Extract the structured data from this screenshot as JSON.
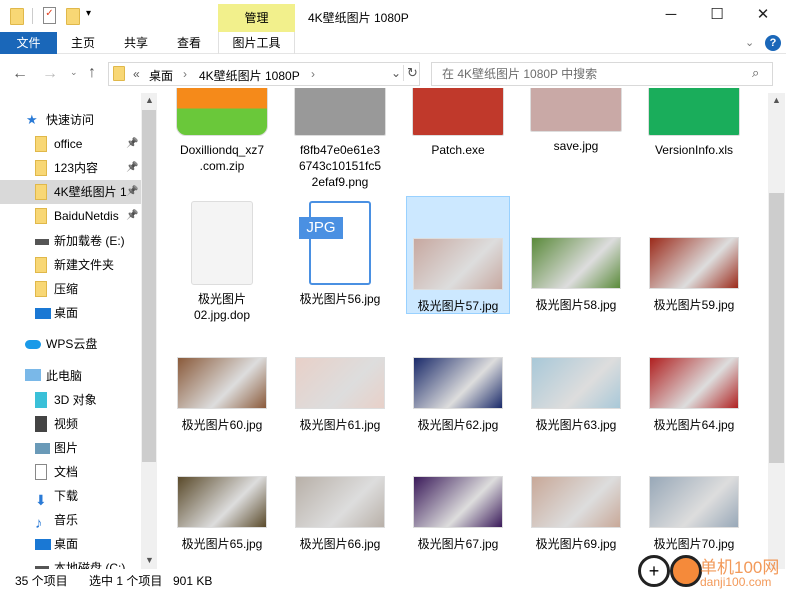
{
  "window": {
    "title": "4K壁纸图片 1080P",
    "context_tab": "管理",
    "minimize": "─",
    "maximize": "☐",
    "close": "✕"
  },
  "ribbon": {
    "tabs": [
      "文件",
      "主页",
      "共享",
      "查看",
      "图片工具"
    ],
    "help": "?"
  },
  "address": {
    "path": [
      "桌面",
      "4K壁纸图片 1080P"
    ],
    "overflow": "«",
    "search_placeholder": "在 4K壁纸图片 1080P 中搜索"
  },
  "nav": {
    "items": [
      {
        "label": "快速访问",
        "icon": "star-icon"
      },
      {
        "label": "office",
        "icon": "folder-icon",
        "pinned": true
      },
      {
        "label": "123内容",
        "icon": "folder-icon",
        "pinned": true
      },
      {
        "label": "4K壁纸图片 1",
        "icon": "folder-icon",
        "pinned": true,
        "selected": true
      },
      {
        "label": "BaiduNetdis",
        "icon": "folder-icon",
        "pinned": true
      },
      {
        "label": "新加载卷 (E:)",
        "icon": "drive-icon"
      },
      {
        "label": "新建文件夹",
        "icon": "folder-icon"
      },
      {
        "label": "压缩",
        "icon": "folder-icon"
      },
      {
        "label": "桌面",
        "icon": "desktop-icon"
      },
      {
        "label": "WPS云盘",
        "icon": "cloud-icon"
      },
      {
        "label": "此电脑",
        "icon": "computer-icon"
      },
      {
        "label": "3D 对象",
        "icon": "cube-icon"
      },
      {
        "label": "视频",
        "icon": "video-icon"
      },
      {
        "label": "图片",
        "icon": "picture-icon"
      },
      {
        "label": "文档",
        "icon": "document-icon"
      },
      {
        "label": "下载",
        "icon": "download-icon"
      },
      {
        "label": "音乐",
        "icon": "music-icon"
      },
      {
        "label": "桌面",
        "icon": "desktop-icon"
      },
      {
        "label": "本地磁盘 (C:)",
        "icon": "drive-icon"
      }
    ]
  },
  "files": [
    {
      "name": "Doxilliondq_xz7\n.com.zip",
      "color": "#f5a623"
    },
    {
      "name": "f8fb47e0e61e3\n6743c10151fc5\n2efaf9.png",
      "color": "#999999"
    },
    {
      "name": "Patch.exe",
      "color": "#c0392b"
    },
    {
      "name": "save.jpg",
      "color": "#c9a9a6"
    },
    {
      "name": "VersionInfo.xls",
      "color": "#1aad5b"
    },
    {
      "name": "极光图片\n02.jpg.dop",
      "color": "#f4f4f4"
    },
    {
      "name": "极光图片56.jpg",
      "color": "#4a90e2",
      "badge": "JPG"
    },
    {
      "name": "极光图片57.jpg",
      "color": "#c7a8a0",
      "selected": true
    },
    {
      "name": "极光图片58.jpg",
      "color": "#5a8a3a"
    },
    {
      "name": "极光图片59.jpg",
      "color": "#9b2a1a"
    },
    {
      "name": "极光图片60.jpg",
      "color": "#8a5a3a"
    },
    {
      "name": "极光图片61.jpg",
      "color": "#e8d0c8"
    },
    {
      "name": "极光图片62.jpg",
      "color": "#1a2a6a"
    },
    {
      "name": "极光图片63.jpg",
      "color": "#a8c8d8"
    },
    {
      "name": "极光图片64.jpg",
      "color": "#b02020"
    },
    {
      "name": "极光图片65.jpg",
      "color": "#5a4a2a"
    },
    {
      "name": "极光图片66.jpg",
      "color": "#b8b0a8"
    },
    {
      "name": "极光图片67.jpg",
      "color": "#3a1a5a"
    },
    {
      "name": "极光图片69.jpg",
      "color": "#c8a898"
    },
    {
      "name": "极光图片70.jpg",
      "color": "#98a8b8"
    }
  ],
  "status": {
    "count": "35 个项目",
    "selected": "选中 1 个项目",
    "size": "901 KB"
  },
  "watermark": {
    "text": "单机100网",
    "url_text": "danji100.com"
  }
}
